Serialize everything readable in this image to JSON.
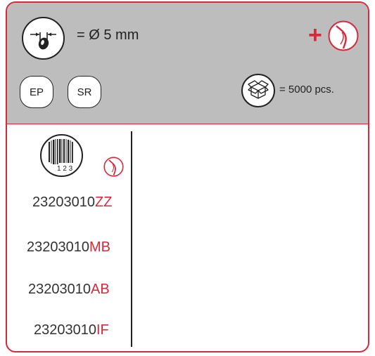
{
  "header": {
    "diameter_text": "= Ø 5 mm",
    "pack_text": "= 5000 pcs.",
    "plus_symbol": "+",
    "buttons": [
      {
        "label": "EP"
      },
      {
        "label": "SR"
      }
    ]
  },
  "barcode": {
    "digits": "1 2 3"
  },
  "codes": [
    {
      "prefix": "23203010",
      "suffix": "ZZ"
    },
    {
      "prefix": "23203010",
      "suffix": "MB"
    },
    {
      "prefix": "23203010",
      "suffix": "AB"
    },
    {
      "prefix": "23203010",
      "suffix": "IF"
    }
  ],
  "colors": {
    "accent": "#d42a3c",
    "header_bg": "#bdbdbd"
  }
}
